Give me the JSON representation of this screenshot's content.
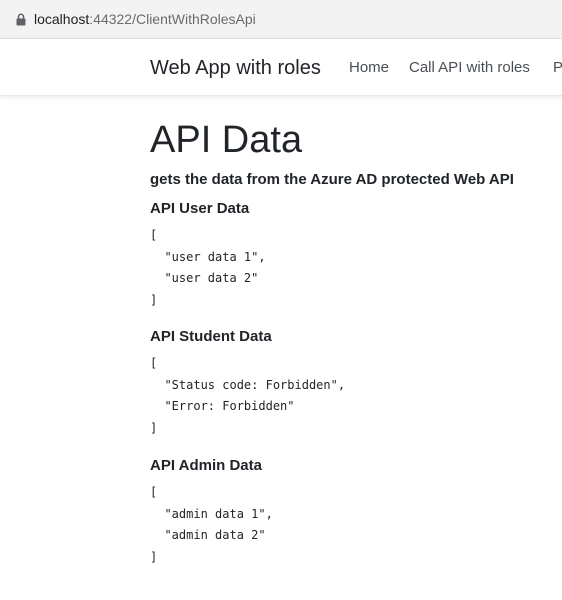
{
  "browser": {
    "url_host": "localhost",
    "url_rest": ":44322/ClientWithRolesApi",
    "lock_icon": "lock-icon"
  },
  "navbar": {
    "brand": "Web App with roles",
    "links": [
      "Home",
      "Call API with roles",
      "P"
    ]
  },
  "main": {
    "title": "API Data",
    "subtitle": "gets the data from the Azure AD protected Web API",
    "sections": [
      {
        "title": "API User Data",
        "json": "[\n  \"user data 1\",\n  \"user data 2\"\n]"
      },
      {
        "title": "API Student Data",
        "json": "[\n  \"Status code: Forbidden\",\n  \"Error: Forbidden\"\n]"
      },
      {
        "title": "API Admin Data",
        "json": "[\n  \"admin data 1\",\n  \"admin data 2\"\n]"
      }
    ]
  }
}
